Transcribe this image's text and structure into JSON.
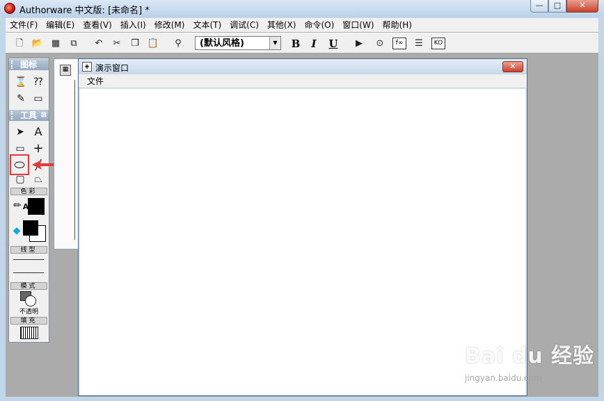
{
  "app": {
    "title": "Authorware 中文版: [未命名] *",
    "caption_buttons": {
      "minimize": "—",
      "maximize": "□",
      "close": "✕"
    }
  },
  "menubar": {
    "items": [
      "文件(F)",
      "编辑(E)",
      "查看(V)",
      "插入(I)",
      "修改(M)",
      "文本(T)",
      "调试(C)",
      "其他(X)",
      "命令(O)",
      "窗口(W)",
      "帮助(H)"
    ]
  },
  "toolbar": {
    "style_combo_value": "(默认风格)",
    "bold_label": "B",
    "italic_label": "I",
    "underline_label": "U",
    "fn_label": "f∞",
    "ko_label": "KO",
    "icons": [
      "new-file-icon",
      "open-file-icon",
      "save-all-icon",
      "import-icon",
      "undo-icon",
      "cut-icon",
      "copy-icon",
      "paste-icon",
      "find-icon",
      "run-icon",
      "control-panel-icon",
      "functions-icon",
      "variables-icon",
      "knowledge-objects-icon"
    ]
  },
  "palette": {
    "icons_header": "图标",
    "tools_header": "工具",
    "color_section": "色彩",
    "line_section": "线型",
    "mode_section": "模式",
    "mode_value": "不透明",
    "fill_section": "填充",
    "text_tool_label": "A",
    "pencil_text_label": "A"
  },
  "presentation_window": {
    "title": "演示窗口",
    "menu_file": "文件",
    "close_label": "✕"
  },
  "watermark": {
    "logo_text": "Bai du 经验",
    "url": "jingyan.baidu.com"
  }
}
